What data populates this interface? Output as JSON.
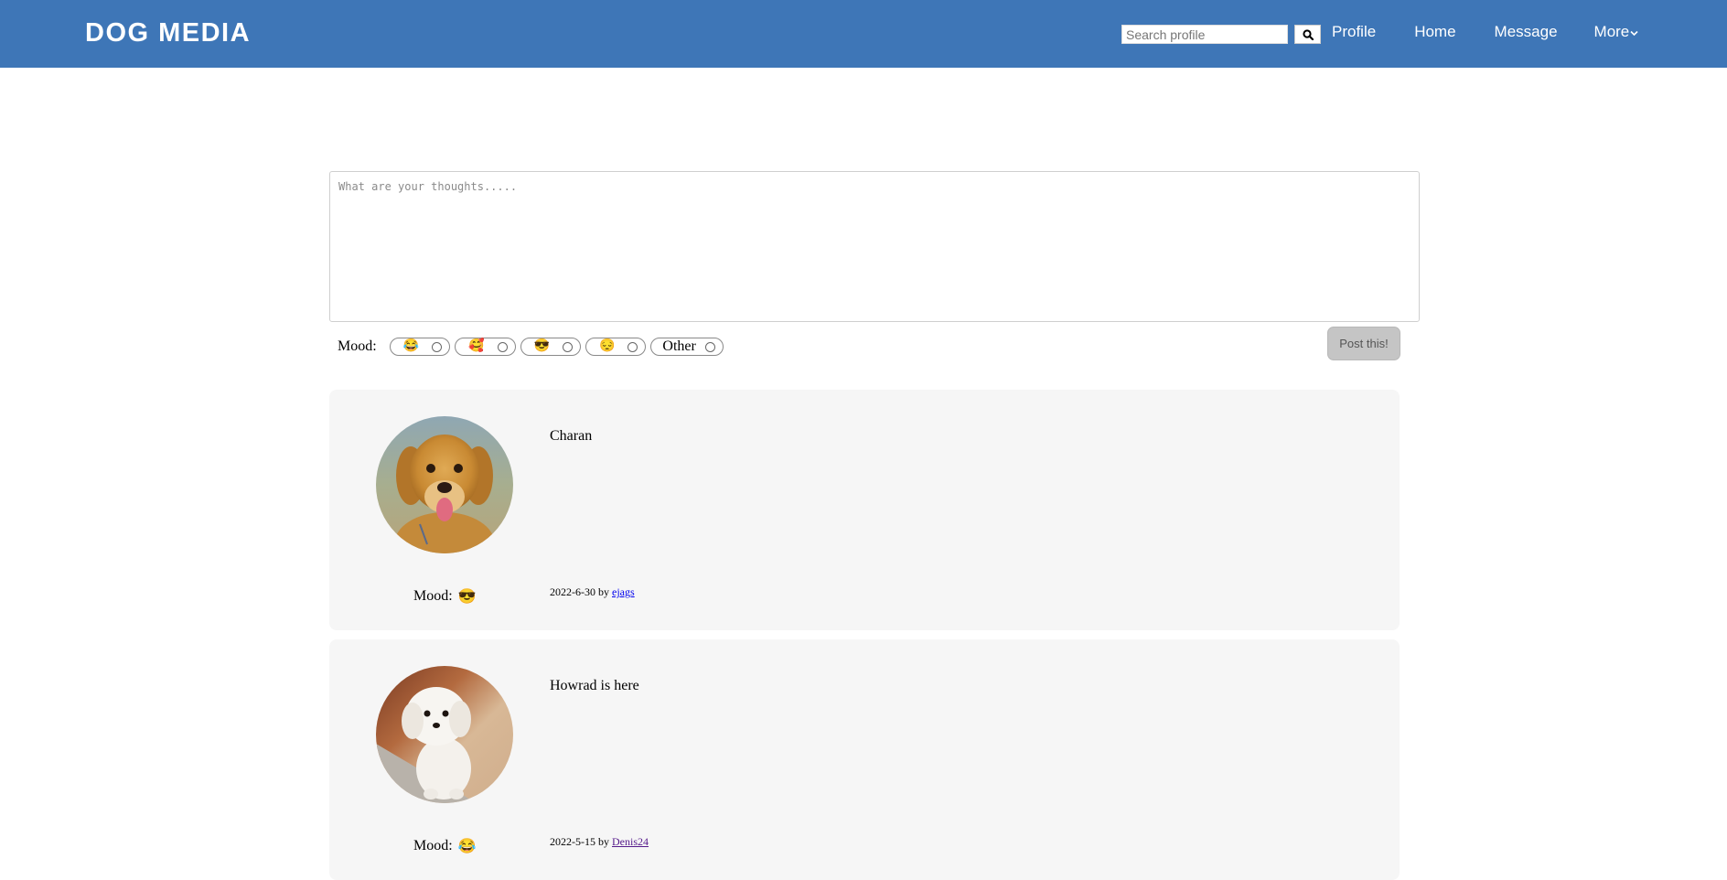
{
  "header": {
    "brand": "DOG MEDIA",
    "search_placeholder": "Search profile",
    "nav": {
      "profile": "Profile",
      "home": "Home",
      "message": "Message",
      "more": "More"
    },
    "colors": {
      "background": "#3e76b7",
      "text": "#ffffff"
    }
  },
  "composer": {
    "placeholder": "What are your thoughts.....",
    "value": ""
  },
  "mood_picker": {
    "label": "Mood:",
    "options": [
      {
        "emoji": "😂",
        "icon": "laughing-face-icon",
        "selected": false
      },
      {
        "emoji": "🥰",
        "icon": "smiling-hearts-face-icon",
        "selected": false
      },
      {
        "emoji": "😎",
        "icon": "sunglasses-face-icon",
        "selected": false
      },
      {
        "emoji": "😔",
        "icon": "pensive-face-icon",
        "selected": false
      },
      {
        "text": "Other",
        "selected": false
      }
    ]
  },
  "post_button": {
    "label": "Post this!"
  },
  "posts": [
    {
      "text": "Charan",
      "mood_label": "Mood:",
      "mood_emoji": "😎",
      "date": "2022-6-30",
      "by": "by",
      "author": "ejags",
      "avatar": "golden-retriever-puppy-photo"
    },
    {
      "text": "Howrad is here",
      "mood_label": "Mood:",
      "mood_emoji": "😂",
      "date": "2022-5-15",
      "by": "by",
      "author": "Denis24",
      "avatar": "white-fluffy-dog-photo"
    }
  ]
}
